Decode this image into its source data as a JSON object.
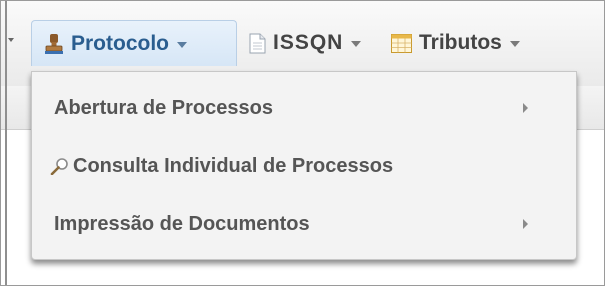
{
  "menubar": {
    "items": [
      {
        "label": "Protocolo",
        "icon": "stamp-icon",
        "active": true
      },
      {
        "label": "ISSQN",
        "icon": "document-icon",
        "active": false
      },
      {
        "label": "Tributos",
        "icon": "table-icon",
        "active": false
      }
    ]
  },
  "dropdown": {
    "items": [
      {
        "label": "Abertura de Processos",
        "has_submenu": true
      },
      {
        "label": "Consulta Individual de Processos",
        "icon": "magnifier-icon",
        "has_submenu": false
      },
      {
        "label": "Impressão de Documentos",
        "has_submenu": true
      }
    ]
  },
  "colors": {
    "active_text": "#2a5d8f",
    "active_bg": "#dce9f7",
    "menu_text": "#444444",
    "dropdown_bg": "#f3f3f3"
  }
}
